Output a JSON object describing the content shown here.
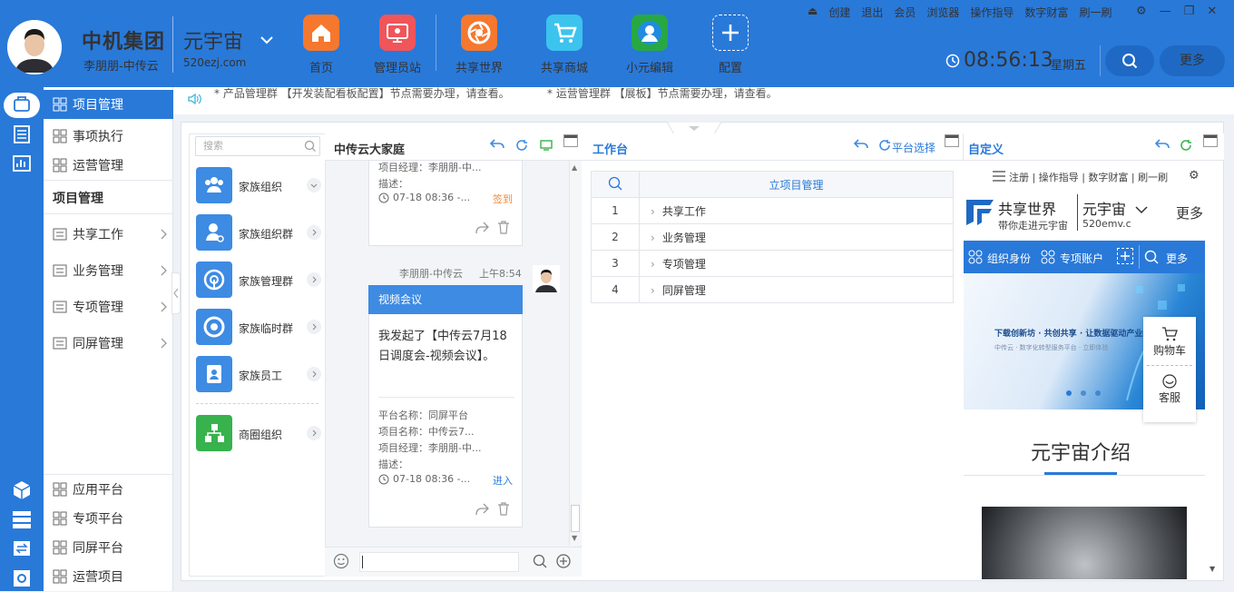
{
  "header": {
    "company": "中机集团",
    "user_name": "李朋朋-中传云",
    "universe": "元宇宙",
    "site": "520ezj.com",
    "nav": [
      {
        "label": "首页",
        "icon": "home-icon",
        "color": "#f5782e"
      },
      {
        "label": "管理员站",
        "icon": "monitor-icon",
        "color": "#f0555a"
      },
      {
        "label": "共享世界",
        "icon": "aperture-icon",
        "color": "#f5782e"
      },
      {
        "label": "共享商城",
        "icon": "cart-icon",
        "color": "#3cc3ee"
      },
      {
        "label": "小元编辑",
        "icon": "globe-icon",
        "color": "#27a844"
      },
      {
        "label": "配置",
        "icon": "plus-icon",
        "color": "transparent"
      }
    ],
    "top_links": [
      "创建",
      "退出",
      "会员",
      "浏览器",
      "操作指导",
      "数字财富",
      "刷一刷"
    ],
    "time": "08:56:13",
    "weekday": "星期五",
    "more": "更多"
  },
  "sidebar": {
    "top_items": [
      {
        "label": "项目管理",
        "icon": "grid-icon"
      },
      {
        "label": "事项执行",
        "icon": "grid-icon"
      },
      {
        "label": "运营管理",
        "icon": "grid-icon"
      }
    ],
    "section_title": "项目管理",
    "sub_items": [
      {
        "label": "共享工作",
        "icon": "list-icon"
      },
      {
        "label": "业务管理",
        "icon": "list-icon"
      },
      {
        "label": "专项管理",
        "icon": "list-icon"
      },
      {
        "label": "同屏管理",
        "icon": "list-icon"
      }
    ],
    "bottom_items": [
      {
        "label": "应用平台",
        "icon": "grid-icon"
      },
      {
        "label": "专项平台",
        "icon": "grid-icon"
      },
      {
        "label": "同屏平台",
        "icon": "grid-icon"
      },
      {
        "label": "运营项目",
        "icon": "grid-icon"
      }
    ]
  },
  "notice": {
    "items": [
      "* 产品管理群 【开发装配看板配置】节点需要办理，请查看。",
      "* 运营管理群 【展板】节点需要办理，请查看。"
    ]
  },
  "contacts": {
    "search_placeholder": "搜索",
    "items": [
      {
        "label": "家族组织",
        "icon": "people-icon"
      },
      {
        "label": "家族组织群",
        "icon": "person-gear-icon"
      },
      {
        "label": "家族管理群",
        "icon": "target-icon"
      },
      {
        "label": "家族临时群",
        "icon": "aperture-icon"
      },
      {
        "label": "家族员工",
        "icon": "badge-icon"
      },
      {
        "label": "商圈组织",
        "icon": "org-icon"
      }
    ]
  },
  "chat": {
    "title": "中传云大家庭",
    "card1": {
      "manager": "项目经理：李朋朋-中...",
      "desc": "描述：",
      "time": "07-18 08:36 -...",
      "action": "签到"
    },
    "sender": "李朋朋-中传云",
    "sent_time": "上午8:54",
    "card2": {
      "header": "视频会议",
      "message": "我发起了【中传云7月18日调度会-视频会议】。",
      "platform": "平台名称：同屏平台",
      "project": "项目名称：中传云7...",
      "manager": "项目经理：李朋朋-中...",
      "desc": "描述：",
      "time": "07-18 08:36 -...",
      "action": "进入"
    }
  },
  "workbench": {
    "title": "工作台",
    "platform_select": "平台选择",
    "table_header": "立项目管理",
    "rows": [
      {
        "num": "1",
        "name": "共享工作"
      },
      {
        "num": "2",
        "name": "业务管理"
      },
      {
        "num": "3",
        "name": "专项管理"
      },
      {
        "num": "4",
        "name": "同屏管理"
      }
    ]
  },
  "custom": {
    "title": "自定义",
    "mini_links": "注册 | 操作指导 | 数字财富 | 刷一刷",
    "brand": "共享世界",
    "brand_sub": "带你走进元宇宙",
    "universe": "元宇宙",
    "site": "520emv.c",
    "more": "更多",
    "bar_items": [
      "组织身份",
      "专项账户",
      "更多"
    ],
    "banner_text": "下载创新坊 · 共创共享 · 让数据驱动产业结构升级",
    "banner_sub": "中传云 · 数字化转型服务平台 · 立即体验",
    "cart": "购物车",
    "service": "客服",
    "intro": "元宇宙介绍"
  },
  "colors": {
    "primary": "#2979d9",
    "accent": "#f08c3c"
  }
}
